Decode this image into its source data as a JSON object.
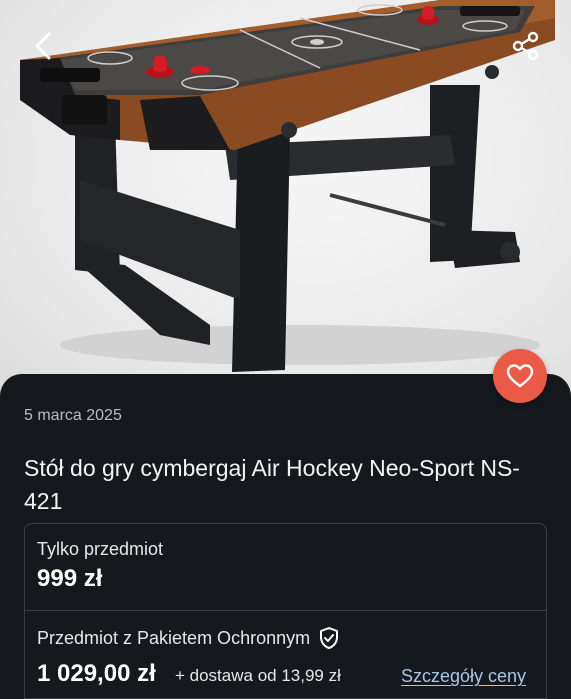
{
  "listing": {
    "date": "5 marca 2025",
    "title": "Stół do gry cymbergaj Air Hockey Neo-Sport NS-421"
  },
  "pricing": {
    "option1": {
      "label": "Tylko przedmiot",
      "price": "999 zł"
    },
    "option2": {
      "label": "Przedmiot z Pakietem Ochronnym",
      "price": "1 029,00 zł",
      "delivery": "+ dostawa od 13,99 zł",
      "details_link": "Szczegóły ceny"
    }
  },
  "icons": {
    "back": "chevron-left-icon",
    "share": "share-icon",
    "favorite": "heart-icon",
    "protection": "shield-check-icon"
  },
  "colors": {
    "background": "#15181d",
    "favorite_button": "#ea5a47",
    "link": "#a7c7e7"
  }
}
